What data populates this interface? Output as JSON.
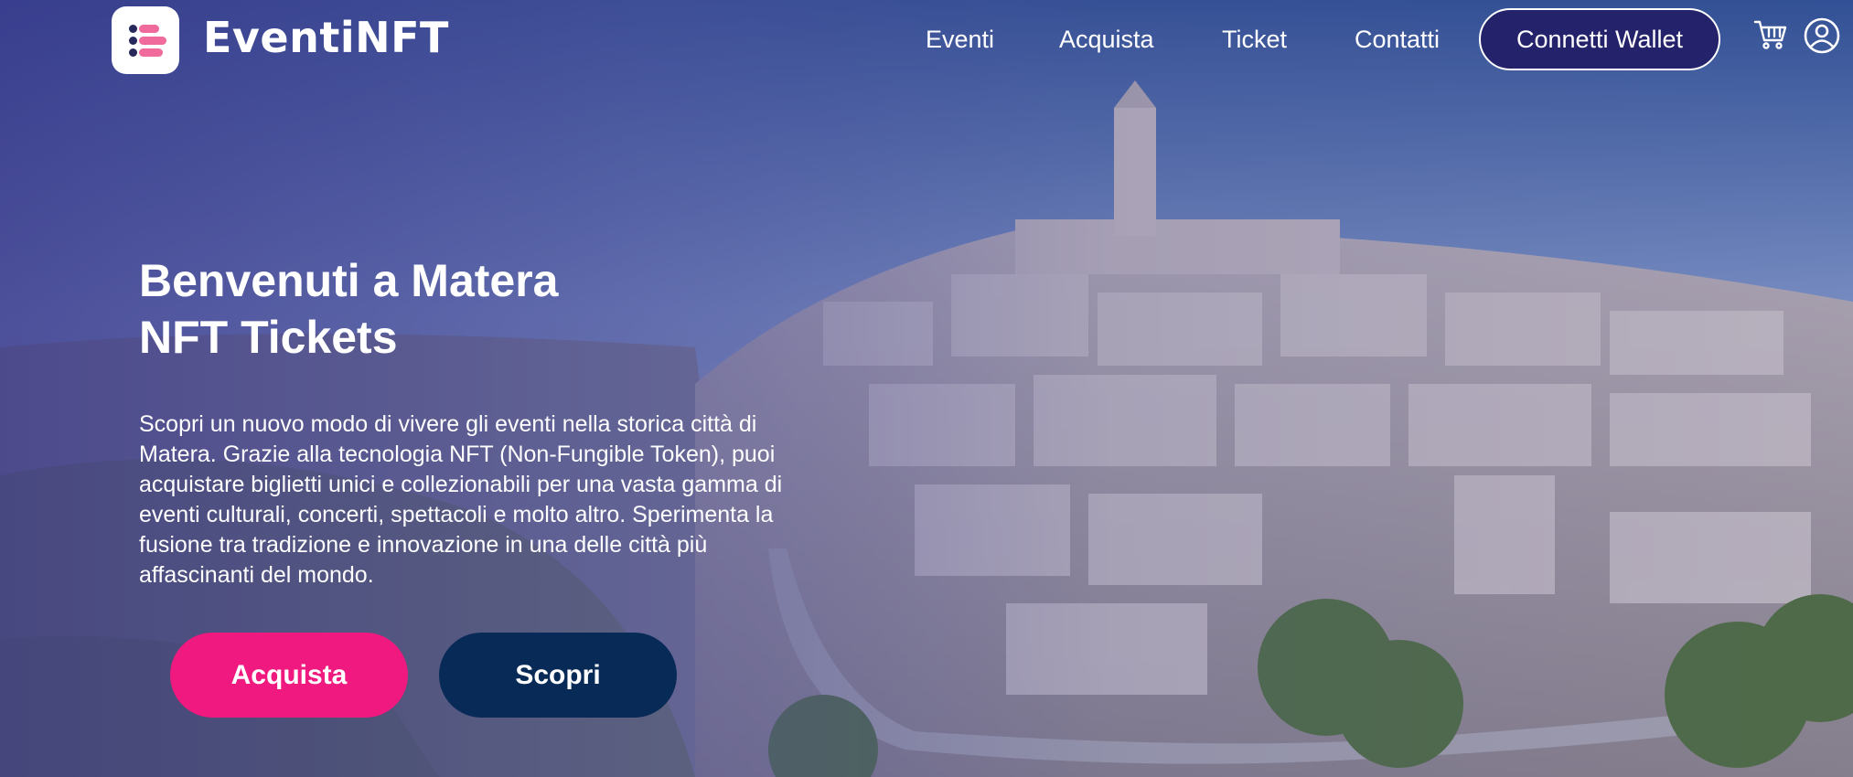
{
  "brand": {
    "name": "EventiNFT"
  },
  "nav": {
    "links": [
      "Eventi",
      "Acquista",
      "Ticket",
      "Contatti"
    ],
    "wallet_label": "Connetti Wallet",
    "icons": [
      "cart-icon",
      "user-icon"
    ]
  },
  "hero": {
    "title_line1": "Benvenuti a Matera",
    "title_line2": "NFT Tickets",
    "description": "Scopri un nuovo modo di vivere gli eventi nella storica città di Matera. Grazie alla tecnologia NFT (Non-Fungible Token), puoi acquistare biglietti unici e collezionabili per una vasta gamma di eventi culturali, concerti, spettacoli e molto altro. Sperimenta la fusione tra tradizione e innovazione in una delle città più affascinanti del mondo.",
    "buy_label": "Acquista",
    "discover_label": "Scopri"
  },
  "colors": {
    "accent_pink": "#f0197f",
    "navy": "#082a57",
    "wallet_bg": "#23226a"
  }
}
